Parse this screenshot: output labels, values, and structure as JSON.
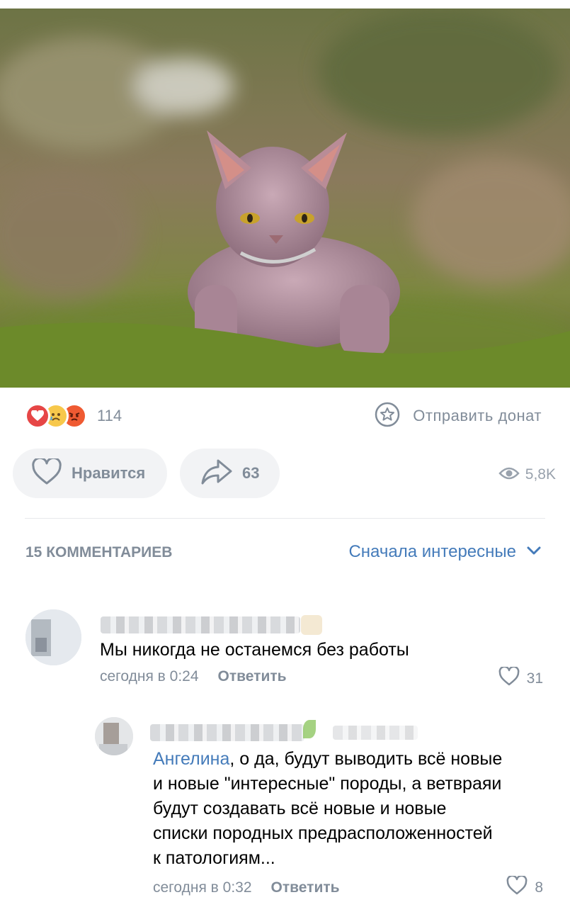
{
  "post": {
    "reaction_count": "114",
    "donate_label": "Отправить донат",
    "like_label": "Нравится",
    "share_count": "63",
    "views": "5,8K"
  },
  "comments_header": {
    "count_label": "15 КОММЕНТАРИЕВ",
    "sort_label": "Сначала интересные"
  },
  "comments": [
    {
      "text": "Мы никогда не останемся без работы",
      "time": "сегодня в 0:24",
      "reply_label": "Ответить",
      "likes": "31"
    },
    {
      "mention": "Ангелина",
      "text_lines": [
        ", о да, будут выводить всё новые",
        "и новые \"интересные\" породы, а ветвраяи",
        "будут создавать всё новые и новые",
        "списки породных предрасположенностей",
        "к патологиям..."
      ],
      "time": "сегодня в 0:32",
      "reply_label": "Ответить",
      "likes": "8"
    }
  ],
  "icons": {
    "reaction_1": "heart-reaction-icon",
    "reaction_2": "crying-reaction-icon",
    "reaction_3": "angry-reaction-icon",
    "donate": "star-coin-icon",
    "like": "heart-outline-icon",
    "share": "share-arrow-icon",
    "views": "eye-icon",
    "sort": "chevron-down-icon"
  },
  "colors": {
    "accent": "#447bba",
    "secondary_text": "#818c99",
    "pill_bg": "#f2f3f5",
    "reaction_red": "#e64646"
  }
}
